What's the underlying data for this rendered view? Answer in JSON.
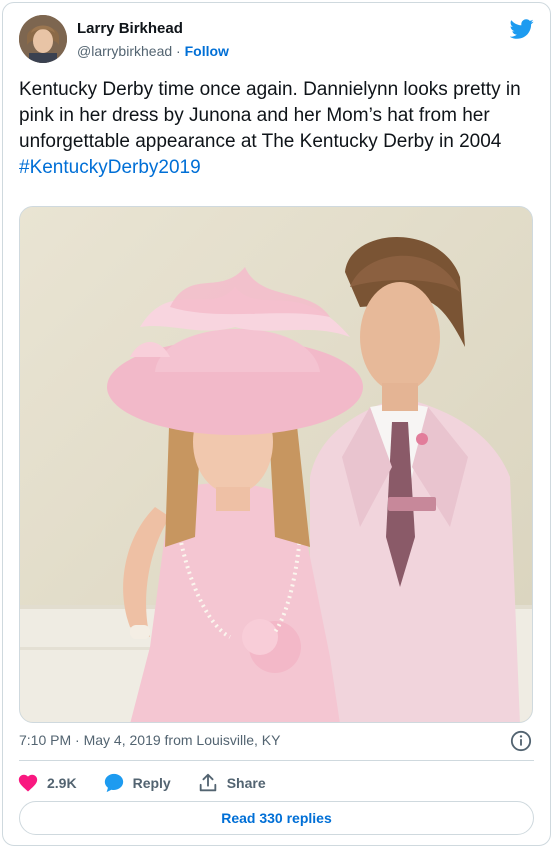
{
  "author": {
    "name": "Larry Birkhead",
    "handle": "@larrybirkhead",
    "separator": "·",
    "follow_label": "Follow"
  },
  "tweet": {
    "text": "Kentucky Derby time once again.  Dannielynn looks pretty in pink in her dress by Junona and her Mom’s hat from her unforgettable appearance at The Kentucky Derby in 2004",
    "hashtag": "#KentuckyDerby2019"
  },
  "meta": {
    "time": "7:10 PM",
    "separator": "·",
    "date": "May 4, 2019",
    "source": "from Louisville, KY"
  },
  "actions": {
    "like_count": "2.9K",
    "reply_label": "Reply",
    "share_label": "Share"
  },
  "read_replies_label": "Read 330 replies",
  "colors": {
    "accent": "#006fd6",
    "like": "#f91880",
    "twitter_blue": "#1d9bf0",
    "reply_icon": "#1d9bf0"
  },
  "icons": [
    "twitter-bird-icon",
    "info-icon",
    "heart-icon",
    "reply-bubble-icon",
    "share-icon"
  ]
}
